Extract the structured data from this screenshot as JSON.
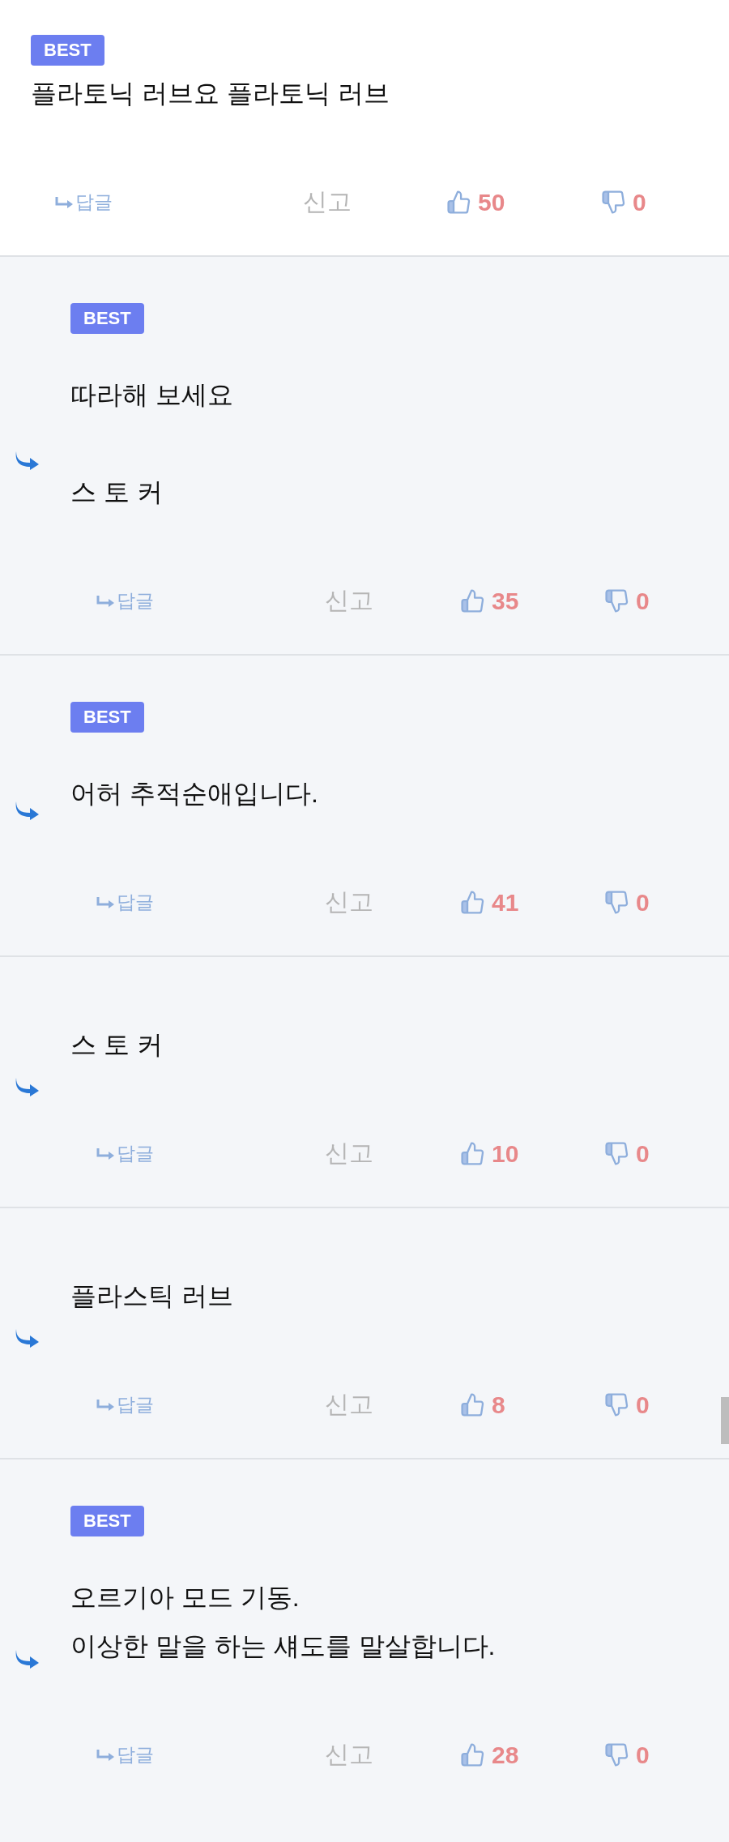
{
  "comments": [
    {
      "kind": "comment",
      "badge": "BEST",
      "text": "플라토닉 러브요 플라토닉 러브",
      "reply_label": "답글",
      "report_label": "신고",
      "likes": "50",
      "dislikes": "0"
    },
    {
      "kind": "reply",
      "badge": "BEST",
      "text": "따라해 보세요\n\n스 토 커",
      "reply_label": "답글",
      "report_label": "신고",
      "likes": "35",
      "dislikes": "0"
    },
    {
      "kind": "reply",
      "badge": "BEST",
      "text": "어허 추적순애입니다.",
      "reply_label": "답글",
      "report_label": "신고",
      "likes": "41",
      "dislikes": "0"
    },
    {
      "kind": "reply",
      "text": "스 토 커",
      "reply_label": "답글",
      "report_label": "신고",
      "likes": "10",
      "dislikes": "0"
    },
    {
      "kind": "reply",
      "text": "플라스틱 러브",
      "reply_label": "답글",
      "report_label": "신고",
      "likes": "8",
      "dislikes": "0"
    },
    {
      "kind": "reply",
      "badge": "BEST",
      "text": "오르기아 모드 기동.\n이상한 말을 하는 섀도를 말살합니다.",
      "reply_label": "답글",
      "report_label": "신고",
      "likes": "28",
      "dislikes": "0"
    }
  ]
}
